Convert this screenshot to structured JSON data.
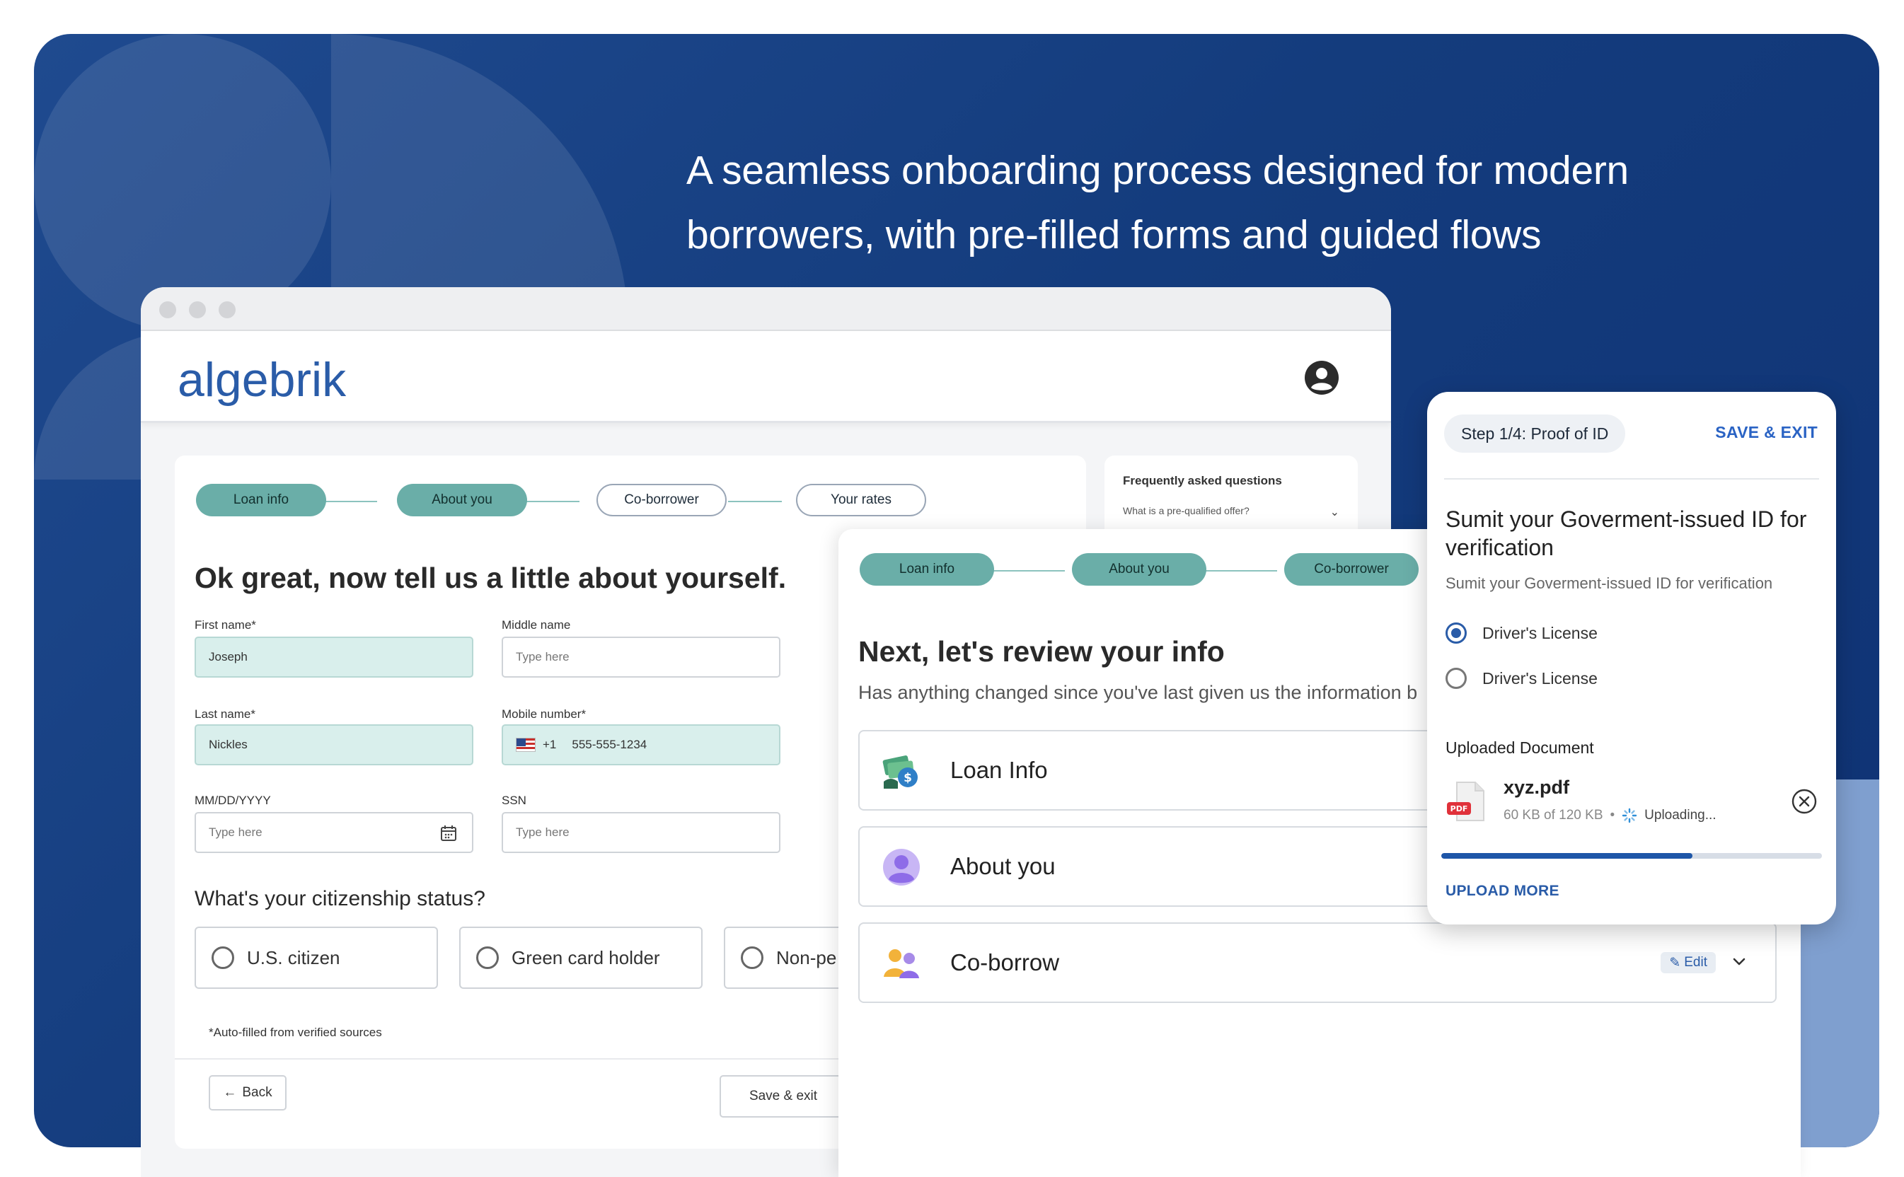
{
  "headline": {
    "line1": "A seamless onboarding process designed for modern",
    "line2": "borrowers, with pre-filled forms and guided flows"
  },
  "app": {
    "logo": "algebrik"
  },
  "steps": {
    "form": [
      "Loan info",
      "About you",
      "Co-borrower",
      "Your rates"
    ],
    "review": [
      "Loan info",
      "About you",
      "Co-borrower"
    ]
  },
  "faq": {
    "title": "Frequently asked questions",
    "question": "What is a pre-qualified offer?"
  },
  "form": {
    "title": "Ok great, now tell us a little about yourself.",
    "first_name": {
      "label": "First name*",
      "value": "Joseph"
    },
    "middle_name": {
      "label": "Middle name",
      "placeholder": "Type here"
    },
    "last_name": {
      "label": "Last name*",
      "value": "Nickles"
    },
    "mobile": {
      "label": "Mobile number*",
      "code": "+1",
      "value": "555-555-1234"
    },
    "dob": {
      "label": "MM/DD/YYYY",
      "placeholder": "Type here"
    },
    "ssn": {
      "label": "SSN",
      "placeholder": "Type here"
    },
    "citizenship": {
      "title": "What's your citizenship status?",
      "options": [
        "U.S. citizen",
        "Green card holder",
        "Non-pe"
      ]
    },
    "autofill_note": "*Auto-filled from verified sources",
    "back_label": "Back",
    "save_label": "Save & exit"
  },
  "review": {
    "title": "Next, let's review your info",
    "subtitle": "Has anything changed since you've last given us the information b",
    "items": [
      {
        "label": "Loan Info",
        "icon": "loan-money-icon"
      },
      {
        "label": "About you",
        "icon": "person-icon"
      },
      {
        "label": "Co-borrow",
        "icon": "people-icon",
        "edit": "Edit"
      }
    ]
  },
  "id_card": {
    "step": "Step 1/4: Proof of ID",
    "save_exit": "SAVE & EXIT",
    "title": "Sumit your Goverment-issued ID for verification",
    "subtitle": "Sumit your Goverment-issued ID for verification",
    "options": [
      {
        "label": "Driver's License",
        "selected": true
      },
      {
        "label": "Driver's License",
        "selected": false
      }
    ],
    "uploaded_label": "Uploaded Document",
    "file": {
      "name": "xyz.pdf",
      "badge": "PDF",
      "size": "60 KB of 120 KB",
      "status": "Uploading...",
      "progress": 0.66
    },
    "upload_more": "UPLOAD MORE"
  },
  "colors": {
    "hero_bg": "#143c7d",
    "accent_teal": "#6aaea8",
    "brand_blue": "#2a5ca8",
    "filled_input": "#d9efec"
  }
}
